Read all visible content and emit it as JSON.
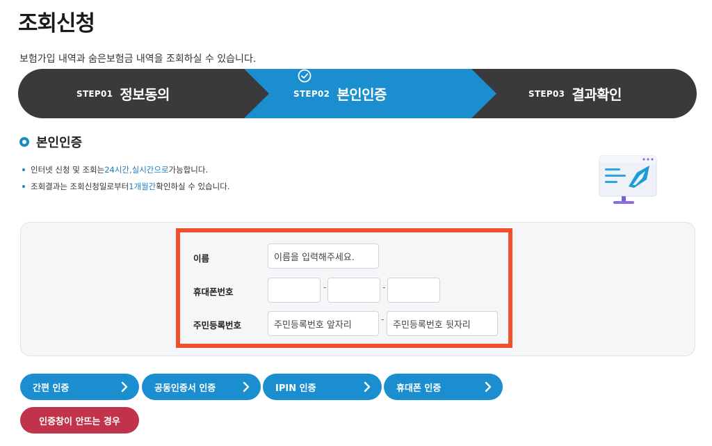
{
  "page": {
    "title": "조회신청",
    "subtitle": "보험가입 내역과 숨은보험금 내역을 조회하실 수 있습니다."
  },
  "steps": [
    {
      "num": "STEP01",
      "name": "정보동의",
      "active": false
    },
    {
      "num": "STEP02",
      "name": "본인인증",
      "active": true
    },
    {
      "num": "STEP03",
      "name": "결과확인",
      "active": false
    }
  ],
  "section": {
    "title": "본인인증"
  },
  "notes": {
    "n1_a": "인터넷 신청 및 조회는 ",
    "n1_h1": "24시간",
    "n1_b": ", ",
    "n1_h2": "실시간으로",
    "n1_c": " 가능합니다.",
    "n2_a": "조회결과는 조회신청일로부터 ",
    "n2_h": "1개월간",
    "n2_b": " 확인하실 수 있습니다."
  },
  "form": {
    "name_label": "이름",
    "name_placeholder": "이름을 입력해주세요.",
    "phone_label": "휴대폰번호",
    "phone_sep": "-",
    "rrn_label": "주민등록번호",
    "rrn_front_placeholder": "주민등록번호 앞자리",
    "rrn_sep": "-",
    "rrn_back_placeholder": "주민등록번호 뒷자리"
  },
  "auth_buttons": [
    {
      "label": "간편 인증"
    },
    {
      "label": "공동인증서 인증"
    },
    {
      "label": "IPIN 인증"
    },
    {
      "label": "휴대폰 인증"
    }
  ],
  "trouble_button": "인증창이 안뜨는 경우",
  "colors": {
    "step_dark": "#3a3a3c",
    "step_active": "#1b8ed0",
    "accent": "#1a8bc7",
    "highlight_frame": "#f0502e",
    "trouble": "#c0334a"
  }
}
